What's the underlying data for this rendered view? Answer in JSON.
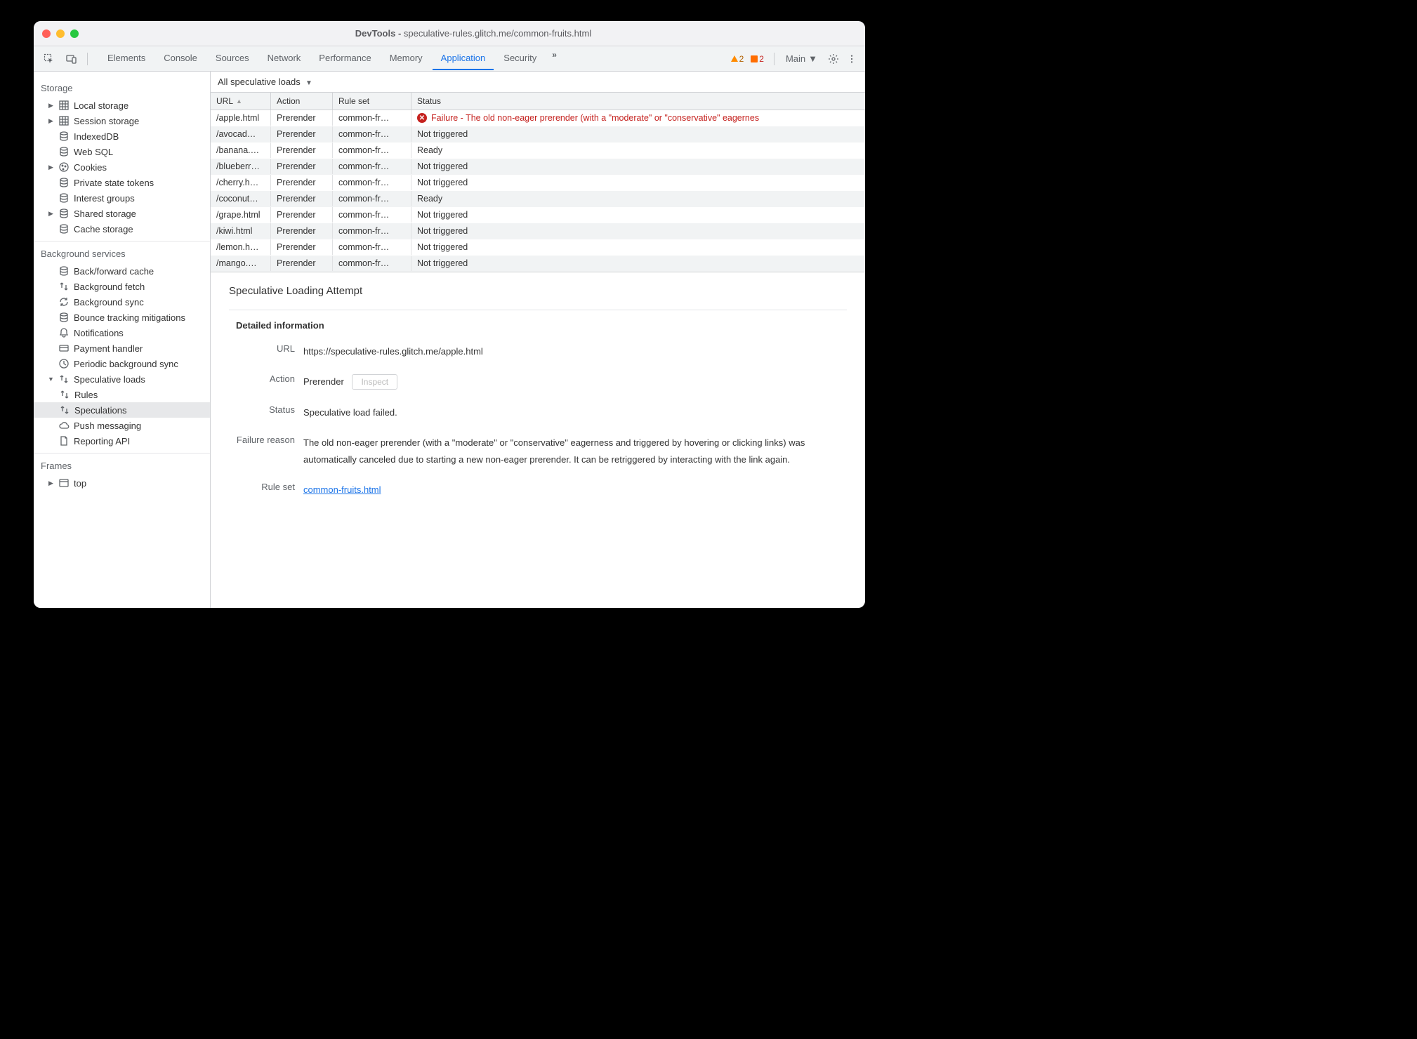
{
  "window": {
    "title_prefix": "DevTools - ",
    "title_path": "speculative-rules.glitch.me/common-fruits.html"
  },
  "toolbar": {
    "tabs": [
      "Elements",
      "Console",
      "Sources",
      "Network",
      "Performance",
      "Memory",
      "Application",
      "Security"
    ],
    "active_tab": "Application",
    "overflow": "»",
    "warn_count": "2",
    "err_count": "2",
    "frame_label": "Main"
  },
  "sidebar": {
    "sections": {
      "storage": {
        "label": "Storage",
        "items": [
          {
            "label": "Local storage",
            "expandable": true
          },
          {
            "label": "Session storage",
            "expandable": true
          },
          {
            "label": "IndexedDB"
          },
          {
            "label": "Web SQL"
          },
          {
            "label": "Cookies",
            "expandable": true
          },
          {
            "label": "Private state tokens"
          },
          {
            "label": "Interest groups"
          },
          {
            "label": "Shared storage",
            "expandable": true
          },
          {
            "label": "Cache storage"
          }
        ]
      },
      "background": {
        "label": "Background services",
        "items": [
          {
            "label": "Back/forward cache"
          },
          {
            "label": "Background fetch"
          },
          {
            "label": "Background sync"
          },
          {
            "label": "Bounce tracking mitigations"
          },
          {
            "label": "Notifications"
          },
          {
            "label": "Payment handler"
          },
          {
            "label": "Periodic background sync"
          },
          {
            "label": "Speculative loads",
            "expanded": true,
            "children": [
              {
                "label": "Rules"
              },
              {
                "label": "Speculations",
                "selected": true
              }
            ]
          },
          {
            "label": "Push messaging"
          },
          {
            "label": "Reporting API"
          }
        ]
      },
      "frames": {
        "label": "Frames",
        "items": [
          {
            "label": "top",
            "expandable": true
          }
        ]
      }
    }
  },
  "filter": {
    "label": "All speculative loads"
  },
  "grid": {
    "headers": [
      "URL",
      "Action",
      "Rule set",
      "Status"
    ],
    "rows": [
      {
        "url": "/apple.html",
        "action": "Prerender",
        "ruleset": "common-fr…",
        "status": "Failure - The old non-eager prerender (with a \"moderate\" or \"conservative\" eagernes",
        "failed": true
      },
      {
        "url": "/avocad…",
        "action": "Prerender",
        "ruleset": "common-fr…",
        "status": "Not triggered"
      },
      {
        "url": "/banana.…",
        "action": "Prerender",
        "ruleset": "common-fr…",
        "status": "Ready"
      },
      {
        "url": "/blueberr…",
        "action": "Prerender",
        "ruleset": "common-fr…",
        "status": "Not triggered"
      },
      {
        "url": "/cherry.h…",
        "action": "Prerender",
        "ruleset": "common-fr…",
        "status": "Not triggered"
      },
      {
        "url": "/coconut…",
        "action": "Prerender",
        "ruleset": "common-fr…",
        "status": "Ready"
      },
      {
        "url": "/grape.html",
        "action": "Prerender",
        "ruleset": "common-fr…",
        "status": "Not triggered"
      },
      {
        "url": "/kiwi.html",
        "action": "Prerender",
        "ruleset": "common-fr…",
        "status": "Not triggered"
      },
      {
        "url": "/lemon.h…",
        "action": "Prerender",
        "ruleset": "common-fr…",
        "status": "Not triggered"
      },
      {
        "url": "/mango.…",
        "action": "Prerender",
        "ruleset": "common-fr…",
        "status": "Not triggered"
      }
    ]
  },
  "detail": {
    "title": "Speculative Loading Attempt",
    "section": "Detailed information",
    "url_label": "URL",
    "url": "https://speculative-rules.glitch.me/apple.html",
    "action_label": "Action",
    "action": "Prerender",
    "inspect": "Inspect",
    "status_label": "Status",
    "status": "Speculative load failed.",
    "reason_label": "Failure reason",
    "reason": "The old non-eager prerender (with a \"moderate\" or \"conservative\" eagerness and triggered by hovering or clicking links) was automatically canceled due to starting a new non-eager prerender. It can be retriggered by interacting with the link again.",
    "ruleset_label": "Rule set",
    "ruleset": "common-fruits.html"
  }
}
